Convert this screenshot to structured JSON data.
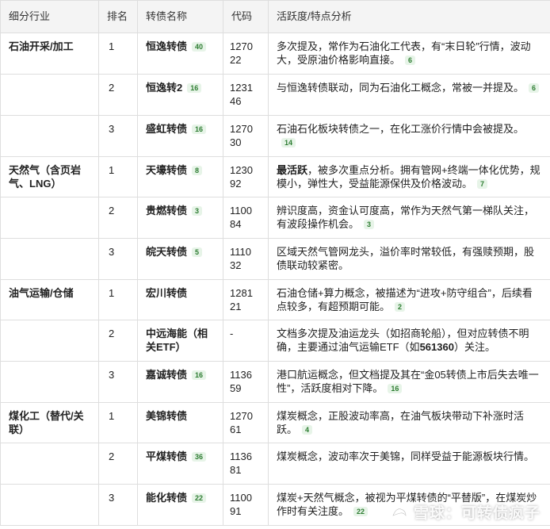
{
  "table": {
    "headers": [
      "细分行业",
      "排名",
      "转债名称",
      "代码",
      "活跃度/特点分析"
    ],
    "rows": [
      {
        "industry": "石油开采/加工",
        "rank": "1",
        "name": "恒逸转债",
        "name_badge": "40",
        "code": "127022",
        "analysis": "多次提及，常作为石油化工代表，有“末日轮”行情，波动大，受原油价格影响直接。",
        "analysis_badge": "6"
      },
      {
        "industry": "",
        "rank": "2",
        "name": "恒逸转2",
        "name_badge": "16",
        "code": "123146",
        "analysis": "与恒逸转债联动，同为石油化工概念，常被一并提及。",
        "analysis_badge": "6"
      },
      {
        "industry": "",
        "rank": "3",
        "name": "盛虹转债",
        "name_badge": "16",
        "code": "127030",
        "analysis": "石油石化板块转债之一，在化工涨价行情中会被提及。",
        "analysis_badge": "14"
      },
      {
        "industry": "天然气（含页岩气、LNG）",
        "rank": "1",
        "name": "天壕转债",
        "name_badge": "8",
        "code": "123092",
        "analysis_bold": "最活跃",
        "analysis": "，被多次重点分析。拥有管网+终端一体化优势，规模小，弹性大，受益能源保供及价格波动。",
        "analysis_badge": "7"
      },
      {
        "industry": "",
        "rank": "2",
        "name": "贵燃转债",
        "name_badge": "3",
        "code": "110084",
        "analysis": "辨识度高，资金认可度高，常作为天然气第一梯队关注，有波段操作机会。",
        "analysis_badge": "3"
      },
      {
        "industry": "",
        "rank": "3",
        "name": "皖天转债",
        "name_badge": "5",
        "code": "111032",
        "analysis": "区域天然气管网龙头，溢价率时常较低，有强赎预期，股债联动较紧密。",
        "analysis_badge": ""
      },
      {
        "industry": "油气运输/仓储",
        "rank": "1",
        "name": "宏川转债",
        "name_badge": "",
        "code": "128121",
        "analysis": "石油仓储+算力概念，被描述为“进攻+防守组合”，后续看点较多，有超预期可能。",
        "analysis_badge": "2"
      },
      {
        "industry": "",
        "rank": "2",
        "name": "中远海能（相关ETF）",
        "name_badge": "",
        "code": "-",
        "analysis": "文档多次提及油运龙头（如招商轮船），但对应转债不明确，主要通过油气运输ETF（如",
        "analysis_bold2": "561360",
        "analysis_tail": "）关注。",
        "analysis_badge": ""
      },
      {
        "industry": "",
        "rank": "3",
        "name": "嘉诚转债",
        "name_badge": "16",
        "code": "113659",
        "analysis": "港口航运概念，但文档提及其在“金05转债上市后失去唯一性”，活跃度相对下降。",
        "analysis_badge": "16"
      },
      {
        "industry": "煤化工（替代/关联）",
        "rank": "1",
        "name": "美锦转债",
        "name_badge": "",
        "code": "127061",
        "analysis": "煤炭概念，正股波动率高，在油气板块带动下补涨时活跃。",
        "analysis_badge": "4"
      },
      {
        "industry": "",
        "rank": "2",
        "name": "平煤转债",
        "name_badge": "36",
        "code": "113681",
        "analysis": "煤炭概念，波动率次于美锦，同样受益于能源板块行情。",
        "analysis_badge": ""
      },
      {
        "industry": "",
        "rank": "3",
        "name": "能化转债",
        "name_badge": "22",
        "code": "110091",
        "analysis": "煤炭+天然气概念，被视为平煤转债的“平替版”，在煤炭炒作时有关注度。",
        "analysis_badge": "22"
      }
    ]
  },
  "watermark": {
    "text": "雪球：可转债疯子"
  }
}
